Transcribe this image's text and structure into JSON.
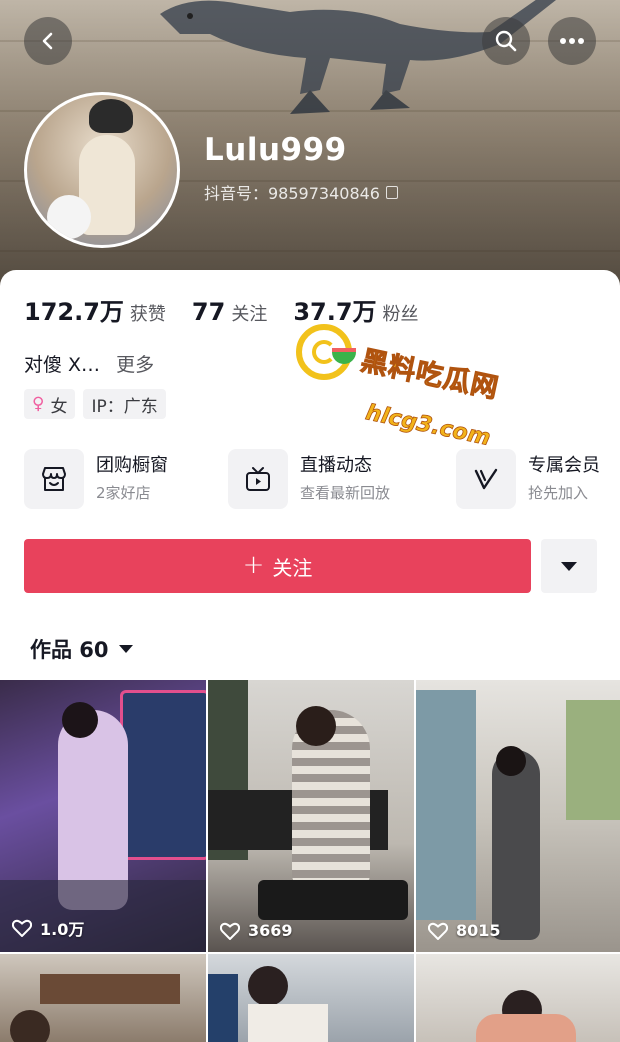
{
  "header": {
    "username": "Lulu999",
    "douyin_id": "抖音号：98597340846"
  },
  "stats": [
    {
      "value": "172.7万",
      "label": "获赞"
    },
    {
      "value": "77",
      "label": "关注"
    },
    {
      "value": "37.7万",
      "label": "粉丝"
    }
  ],
  "bio": {
    "text": "对傻 X…",
    "more": "更多"
  },
  "tags": {
    "gender": "女",
    "ip": "IP：广东"
  },
  "services": [
    {
      "title": "团购橱窗",
      "subtitle": "2家好店",
      "icon": "shop-icon"
    },
    {
      "title": "直播动态",
      "subtitle": "查看最新回放",
      "icon": "tv-icon"
    },
    {
      "title": "专属会员",
      "subtitle": "抢先加入",
      "icon": "v-icon"
    }
  ],
  "actions": {
    "follow_label": "关注",
    "follow_plus": "+"
  },
  "works": {
    "label": "作品 60"
  },
  "videos": [
    {
      "likes": "1.0万"
    },
    {
      "likes": "3669"
    },
    {
      "likes": "8015"
    }
  ],
  "watermark": {
    "title": "黑料吃瓜网",
    "url": "hlcg3.com"
  },
  "colors": {
    "follow_button": "#e8425c",
    "watermark": "#f2b31b"
  }
}
